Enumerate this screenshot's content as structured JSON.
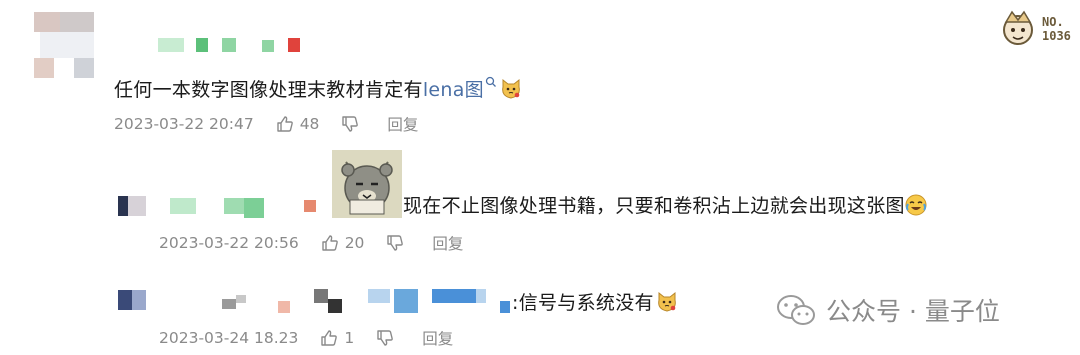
{
  "badge": {
    "line1": "NO.",
    "line2": "1036"
  },
  "comments": [
    {
      "text": "任何一本数字图像处理末教材肯定有",
      "link": "lena图",
      "time": "2023-03-22 20:47",
      "likes": "48",
      "reply": "回复"
    },
    {
      "text": "现在不止图像处理书籍，只要和卷积沾上边就会出现这张图",
      "time": "2023-03-22 20:56",
      "likes": "20",
      "reply": "回复"
    },
    {
      "text": ":信号与系统没有",
      "time": "2023-03-24 18.23",
      "likes": "1",
      "reply": "回复"
    }
  ],
  "watermark": {
    "text": "公众号 · 量子位"
  }
}
